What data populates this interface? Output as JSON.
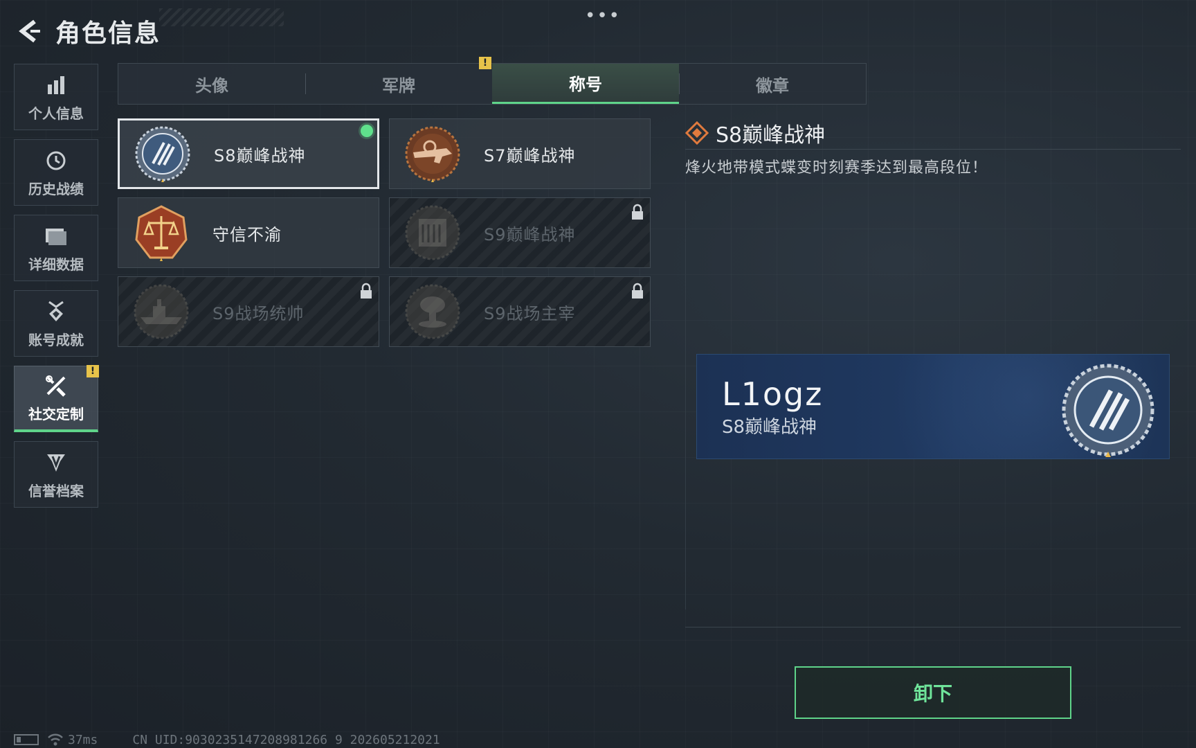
{
  "header": {
    "title": "角色信息",
    "menu": "•••"
  },
  "sidebar": {
    "items": [
      {
        "label": "个人信息",
        "icon": "bar-chart-icon"
      },
      {
        "label": "历史战绩",
        "icon": "history-clock-icon"
      },
      {
        "label": "详细数据",
        "icon": "folder-icon"
      },
      {
        "label": "账号成就",
        "icon": "achievement-medal-icon"
      },
      {
        "label": "社交定制",
        "icon": "tools-icon",
        "active": true,
        "notice": "!"
      },
      {
        "label": "信誉档案",
        "icon": "shield-badge-icon"
      }
    ]
  },
  "tabs": [
    {
      "label": "头像"
    },
    {
      "label": "军牌"
    },
    {
      "label": "称号",
      "active": true
    },
    {
      "label": "徽章"
    }
  ],
  "tab_notice": "!",
  "titles": [
    {
      "name": "S8巅峰战神",
      "badge": "wreath-emblem-icon",
      "selected": true,
      "equipped": true
    },
    {
      "name": "S7巅峰战神",
      "badge": "rifle-emblem-icon"
    },
    {
      "name": "守信不渝",
      "badge": "scales-emblem-icon"
    },
    {
      "name": "S9巅峰战神",
      "badge": "building-emblem-icon",
      "locked": true
    },
    {
      "name": "S9战场统帅",
      "badge": "warship-emblem-icon",
      "locked": true
    },
    {
      "name": "S9战场主宰",
      "badge": "mushroom-cloud-emblem-icon",
      "locked": true
    }
  ],
  "detail": {
    "title": "S8巅峰战神",
    "description": "烽火地带模式蝶变时刻赛季达到最高段位！"
  },
  "preview": {
    "username": "L1ogz",
    "title": "S8巅峰战神"
  },
  "action": {
    "label": "卸下"
  },
  "status": {
    "ping": "37ms",
    "uid": "CN UID:9030235147208981266 9 202605212021"
  },
  "colors": {
    "accent": "#5fd48a",
    "notice": "#e7c34a",
    "preview_bg": "#203a62"
  }
}
